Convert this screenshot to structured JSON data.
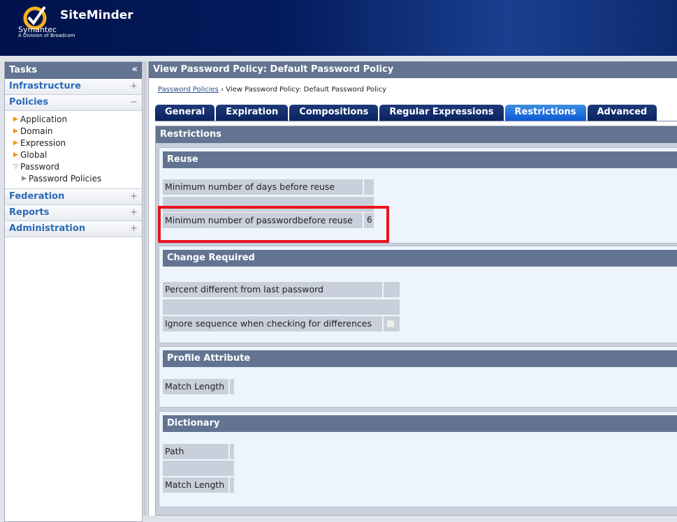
{
  "header": {
    "brand": "Symantec",
    "brand_sub": "A Division of Broadcom",
    "app_title": "SiteMinder"
  },
  "sidebar": {
    "title": "Tasks",
    "collapse_icon": "«",
    "sections": [
      {
        "label": "Infrastructure",
        "state": "+"
      },
      {
        "label": "Policies",
        "state": "−"
      },
      {
        "label": "Federation",
        "state": "+"
      },
      {
        "label": "Reports",
        "state": "+"
      },
      {
        "label": "Administration",
        "state": "+"
      }
    ],
    "policies_tree": [
      "Application",
      "Domain",
      "Expression",
      "Global",
      "Password",
      "Password Policies"
    ]
  },
  "main": {
    "title": "View Password Policy: Default Password Policy",
    "breadcrumb": {
      "link": "Password Policies",
      "sep": "›",
      "current": "View Password Policy: Default Password Policy"
    },
    "tabs": [
      "General",
      "Expiration",
      "Compositions",
      "Regular Expressions",
      "Restrictions",
      "Advanced"
    ],
    "active_tab": "Restrictions",
    "section_title": "Restrictions",
    "reuse": {
      "title": "Reuse",
      "days_label": "Minimum number of days before reuse",
      "days_value": "",
      "pw_label": "Minimum number of passwordbefore reuse",
      "pw_value": "6"
    },
    "change": {
      "title": "Change Required",
      "percent_label": "Percent different from last password",
      "percent_value": "",
      "ignore_label": "Ignore sequence when checking for differences",
      "ignore_checked": false
    },
    "profile": {
      "title": "Profile Attribute",
      "match_label": "Match Length",
      "match_value": ""
    },
    "dictionary": {
      "title": "Dictionary",
      "path_label": "Path",
      "path_value": "",
      "match_label": "Match Length",
      "match_value": ""
    }
  },
  "colors": {
    "header": "#00124a",
    "panel_header": "#627491",
    "active_tab": "#0d5bd3",
    "highlight": "#e8141e"
  }
}
